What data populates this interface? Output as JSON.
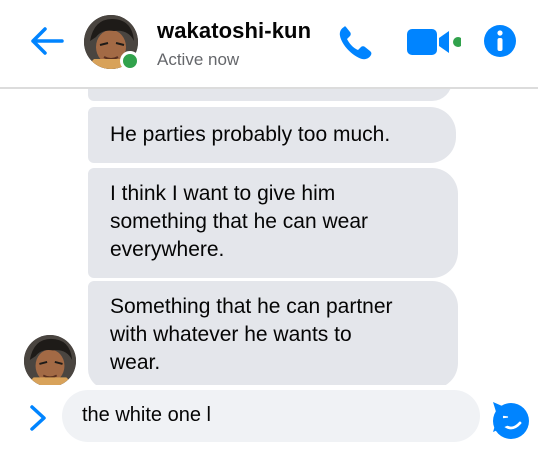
{
  "header": {
    "contact_name": "wakatoshi-kun",
    "status": "Active now"
  },
  "thread": {
    "messages": [
      {
        "text": ""
      },
      {
        "text": "He parties probably too much."
      },
      {
        "lines": [
          "I think I want to give him",
          "something that he can wear",
          "everywhere."
        ]
      },
      {
        "lines": [
          "Something that he can partner",
          "with whatever he wants to",
          "wear."
        ]
      }
    ]
  },
  "composer": {
    "value": "the white one l"
  },
  "colors": {
    "accent": "#0084ff",
    "bubble": "#e4e6eb",
    "online": "#31a24c",
    "input_bg": "#f0f2f5"
  },
  "icons": [
    "back-arrow-icon",
    "phone-icon",
    "video-camera-icon",
    "info-icon",
    "chevron-right-icon",
    "emoji-icon",
    "send-icon"
  ]
}
